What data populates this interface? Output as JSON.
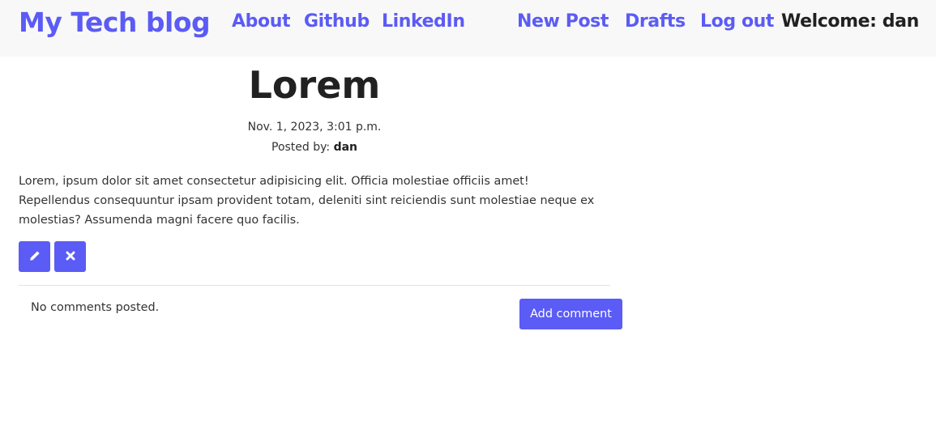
{
  "navbar": {
    "brand": "My Tech blog",
    "links": {
      "about": "About",
      "github": "Github",
      "linkedin": "LinkedIn",
      "new_post": "New Post",
      "drafts": "Drafts",
      "logout": "Log out"
    },
    "welcome": "Welcome: dan"
  },
  "post": {
    "title": "Lorem",
    "date": "Nov. 1, 2023, 3:01 p.m.",
    "posted_by_label": "Posted by: ",
    "author": "dan",
    "body": "Lorem, ipsum dolor sit amet consectetur adipisicing elit. Officia molestiae officiis amet! Repellendus consequuntur ipsam provident totam, deleniti sint reiciendis sunt molestiae neque ex molestias? Assumenda magni facere quo facilis.",
    "edit_icon": "pencil-icon",
    "delete_icon": "x-icon"
  },
  "comments": {
    "empty_text": "No comments posted.",
    "add_label": "Add comment"
  },
  "colors": {
    "accent": "#5b5bf5",
    "navbar_bg": "#f8f8f8",
    "text": "#212121"
  }
}
